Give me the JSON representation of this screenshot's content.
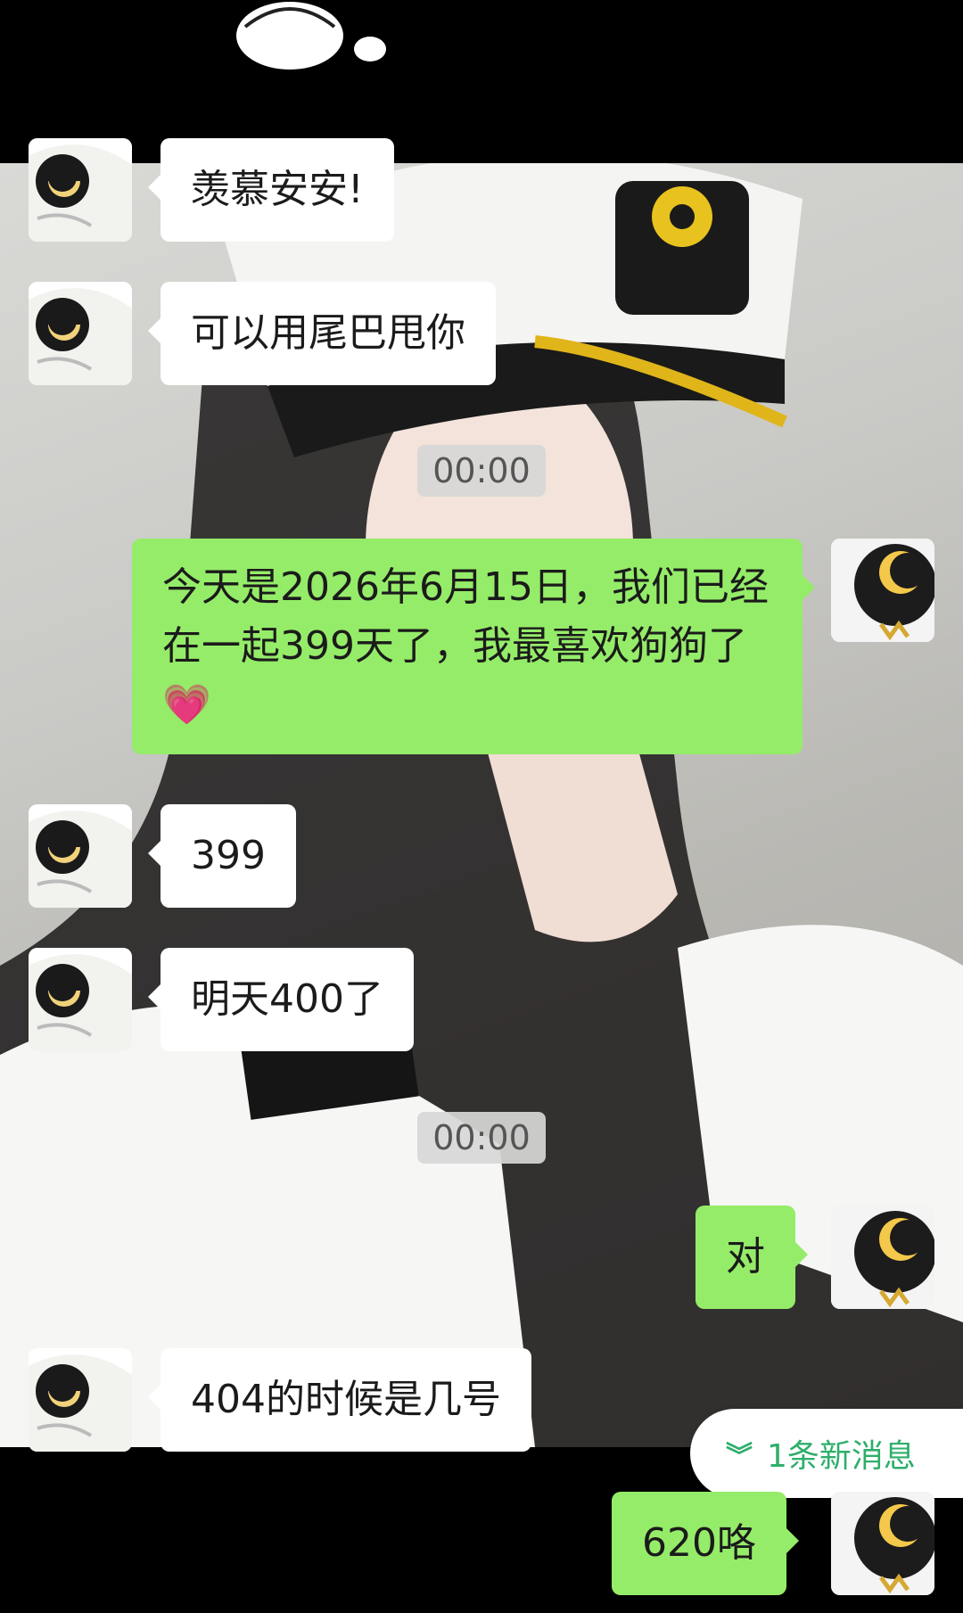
{
  "messages": [
    {
      "side": "in",
      "text": "羡慕安安!"
    },
    {
      "side": "in",
      "text": "可以用尾巴甩你"
    },
    {
      "type": "time",
      "text": "00:00"
    },
    {
      "side": "out",
      "text": "今天是2026年6月15日，我们已经在一起399天了，我最喜欢狗狗了"
    },
    {
      "side": "in",
      "text": "399"
    },
    {
      "side": "in",
      "text": "明天400了"
    },
    {
      "type": "time",
      "text": "00:00"
    },
    {
      "side": "out",
      "text": "对"
    },
    {
      "side": "in",
      "text": "404的时候是几号"
    },
    {
      "side": "out",
      "text": "620咯"
    }
  ],
  "new_messages_pill": {
    "label": "1条新消息"
  },
  "emoji": {
    "heart": "💗"
  },
  "colors": {
    "outgoing_bubble": "#95ec69",
    "incoming_bubble": "#ffffff",
    "time_badge": "#d7d7d7",
    "pill_text": "#2fae6b"
  }
}
